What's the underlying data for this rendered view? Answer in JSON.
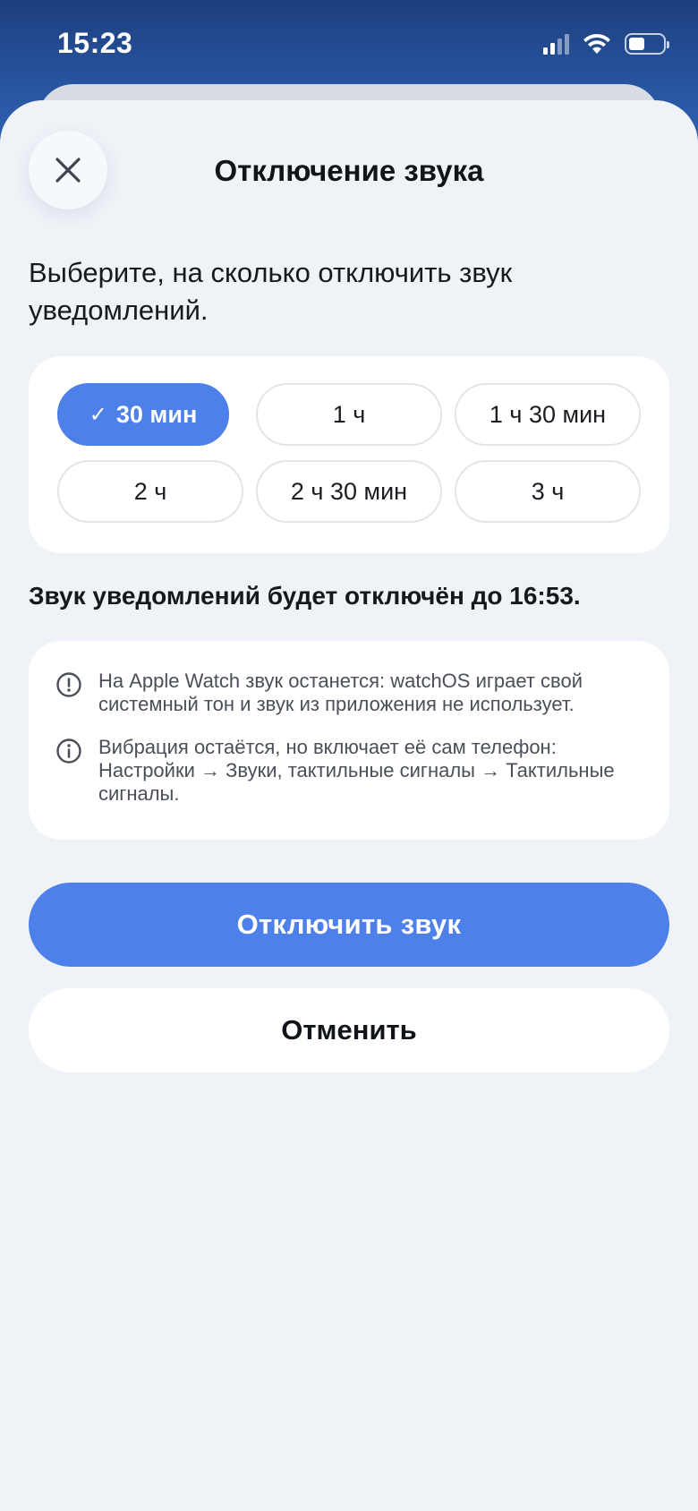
{
  "status_bar": {
    "time": "15:23",
    "icons": [
      "cellular-signal-icon",
      "wifi-icon",
      "battery-icon"
    ],
    "battery_level": 0.48
  },
  "sheet": {
    "title": "Отключение звука",
    "close_icon": "close-icon",
    "prompt": "Выберите, на сколько отключить звук уведомлений.",
    "options": [
      {
        "label": "30 мин",
        "selected": true
      },
      {
        "label": "1 ч",
        "selected": false
      },
      {
        "label": "1 ч 30 мин",
        "selected": false
      },
      {
        "label": "2 ч",
        "selected": false
      },
      {
        "label": "2 ч 30 мин",
        "selected": false
      },
      {
        "label": "3 ч",
        "selected": false
      }
    ],
    "selected_check": "✓",
    "muted_until": "Звук уведомлений будет отключён до 16:53.",
    "notes": [
      {
        "icon": "exclamation-circle-icon",
        "text": "На Apple Watch звук останется: watchOS играет свой системный тон и звук из приложения не использует."
      },
      {
        "icon": "info-circle-icon",
        "text": "Вибрация остаётся, но включает её сам телефон: Настройки → Звуки, тактильные сигналы → Тактильные сигналы."
      }
    ],
    "primary_button": "Отключить звук",
    "secondary_button": "Отменить"
  },
  "colors": {
    "accent": "#4e80ea",
    "sheet_background": "#eff3f8",
    "header_gradient_top": "#1e3f7e"
  }
}
